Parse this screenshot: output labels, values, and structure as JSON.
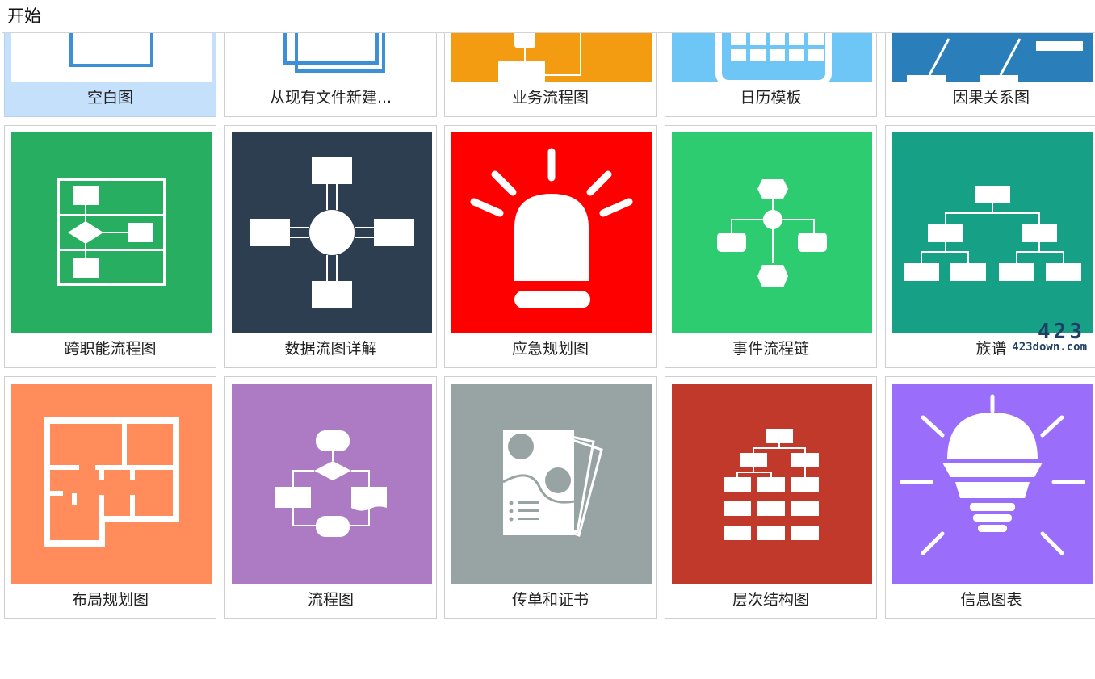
{
  "header": {
    "title": "开始"
  },
  "templates": [
    {
      "label": "空白图",
      "color": "#ffffff",
      "icon": "blank-page-icon",
      "selected": true
    },
    {
      "label": "从现有文件新建...",
      "color": "#ffffff",
      "icon": "stacked-pages-icon"
    },
    {
      "label": "业务流程图",
      "color": "#f39c12",
      "icon": "business-flow-icon"
    },
    {
      "label": "日历模板",
      "color": "#6ec6f7",
      "icon": "calendar-icon"
    },
    {
      "label": "因果关系图",
      "color": "#2a7fba",
      "icon": "cause-effect-icon"
    },
    {
      "label": "跨职能流程图",
      "color": "#27ae60",
      "icon": "cross-functional-flow-icon"
    },
    {
      "label": "数据流图详解",
      "color": "#2c3e50",
      "icon": "data-flow-icon"
    },
    {
      "label": "应急规划图",
      "color": "#ff0000",
      "icon": "alarm-light-icon"
    },
    {
      "label": "事件流程链",
      "color": "#2ecc71",
      "icon": "event-chain-icon"
    },
    {
      "label": "族谱",
      "color": "#16a085",
      "icon": "family-tree-icon"
    },
    {
      "label": "布局规划图",
      "color": "#ff8c5a",
      "icon": "floor-plan-icon"
    },
    {
      "label": "流程图",
      "color": "#ad7ac4",
      "icon": "flowchart-icon"
    },
    {
      "label": "传单和证书",
      "color": "#98a4a4",
      "icon": "flyer-certificate-icon"
    },
    {
      "label": "层次结构图",
      "color": "#c0392b",
      "icon": "hierarchy-icon"
    },
    {
      "label": "信息图表",
      "color": "#9b6dfb",
      "icon": "light-bulb-icon"
    }
  ],
  "watermark": {
    "number": "423",
    "site": "423down.com"
  }
}
